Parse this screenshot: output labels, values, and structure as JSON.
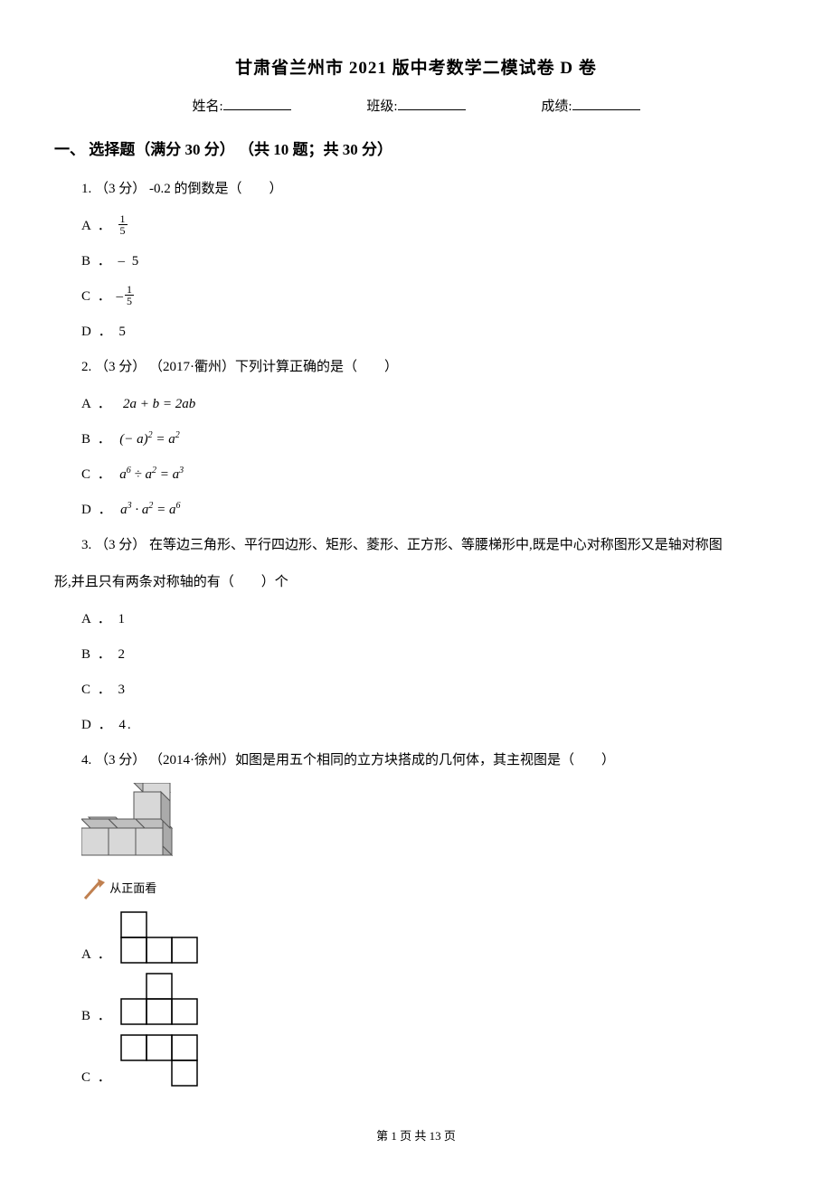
{
  "title": "甘肃省兰州市 2021 版中考数学二模试卷 D 卷",
  "info": {
    "name_label": "姓名:",
    "class_label": "班级:",
    "score_label": "成绩:"
  },
  "section_heading": "一、 选择题（满分 30 分） （共 10 题；共 30 分）",
  "q1": {
    "text": "1.  （3 分）  -0.2 的倒数是（　　）",
    "optA": "A ．",
    "optB": "B ．  – 5",
    "optC": "C ．",
    "optD": "D ．  5"
  },
  "q2": {
    "text": "2.  （3 分） （2017·衢州）下列计算正确的是（　　）",
    "optA": "A ．",
    "optB": "B ．",
    "optC": "C ．",
    "optD": "D ．",
    "mathA": "2a + b = 2ab",
    "mathB_lhs": "(− a)",
    "mathB_exp": "2",
    "mathB_rhs": " = a",
    "mathC_lhs": "a",
    "mathC_e1": "6",
    "mathC_mid": " ÷ a",
    "mathC_e2": "2",
    "mathC_rhs": " = a",
    "mathC_e3": "3",
    "mathD_lhs": "a",
    "mathD_e1": "3",
    "mathD_mid": " · a",
    "mathD_e2": "2",
    "mathD_rhs": " = a",
    "mathD_e3": "6"
  },
  "q3": {
    "line1": "3.  （3 分）  在等边三角形、平行四边形、矩形、菱形、正方形、等腰梯形中,既是中心对称图形又是轴对称图",
    "line2": "形,并且只有两条对称轴的有（　　）个",
    "optA": "A ．  1",
    "optB": "B ．  2",
    "optC": "C ．  3",
    "optD": "D ．  4."
  },
  "q4": {
    "text": "4.  （3 分） （2014·徐州）如图是用五个相同的立方块搭成的几何体，其主视图是（　　）",
    "arrow_label": "从正面看",
    "optA": "A ．",
    "optB": "B ．",
    "optC": "C ．"
  },
  "footer": "第 1 页 共 13 页"
}
